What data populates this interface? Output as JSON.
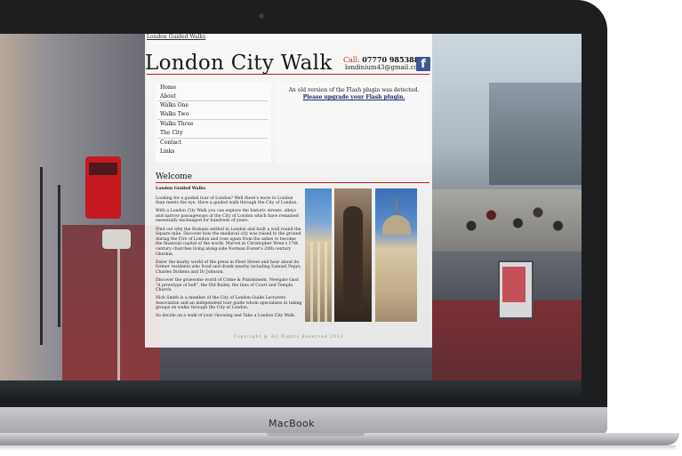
{
  "device": {
    "brand": "MacBook"
  },
  "site": {
    "top_link": "London Guided Walks",
    "title": "London City Walk",
    "call_label": "Call:",
    "phone": "07770 985388",
    "email": "londinium43@gmail.com",
    "facebook_glyph": "f",
    "nav": [
      "Home",
      "About",
      "Walks One",
      "Walks Two",
      "Walks Three",
      "The City",
      "Contact",
      "Links"
    ],
    "flash_notice": "An old version of the Flash plugin was detected.",
    "flash_link": "Please upgrade your Flash plugin.",
    "welcome_heading": "Welcome",
    "body": {
      "heading": "London Guided Walks",
      "p1": "Looking for a guided tour of London? Well there's more to London than meets the eye. Have a guided walk through the City of London.",
      "p2": "With a London City Walk you can explore the historic streets, alleys and narrow passageways of the City of London which have remained essentially unchanged for hundreds of years.",
      "p3": "Find out why the Romans settled in London and built a wall round the Square mile. Discover how the medieval city was raised to the ground during the Fire of London and rose again from the ashes to become the financial capital of the world. Marvel at Christopher Wren's 17th century churches living along-side Norman Foster's 20th century Gherkin.",
      "p4": "Enter the murky world of the press in Fleet Street and hear about its former residents who lived and drank nearby including Samuel Pepys, Charles Dickens and Dr Johnson.",
      "p5": "Discover the gruesome world of Crime & Punishment, Newgate Gaol \"A prototype of hell\", the Old Bailey, the Inns of Court and Temple Church.",
      "p6": "Nick Smith is a member of the City of London Guide Lecturers Association and an independent tour guide whom specializes in taking groups on walks through the City of London.",
      "p7": "So decide on a walk of your choosing and Take a London City Walk."
    },
    "copyright": "Copyright @ All Rights Reserved 2013"
  }
}
